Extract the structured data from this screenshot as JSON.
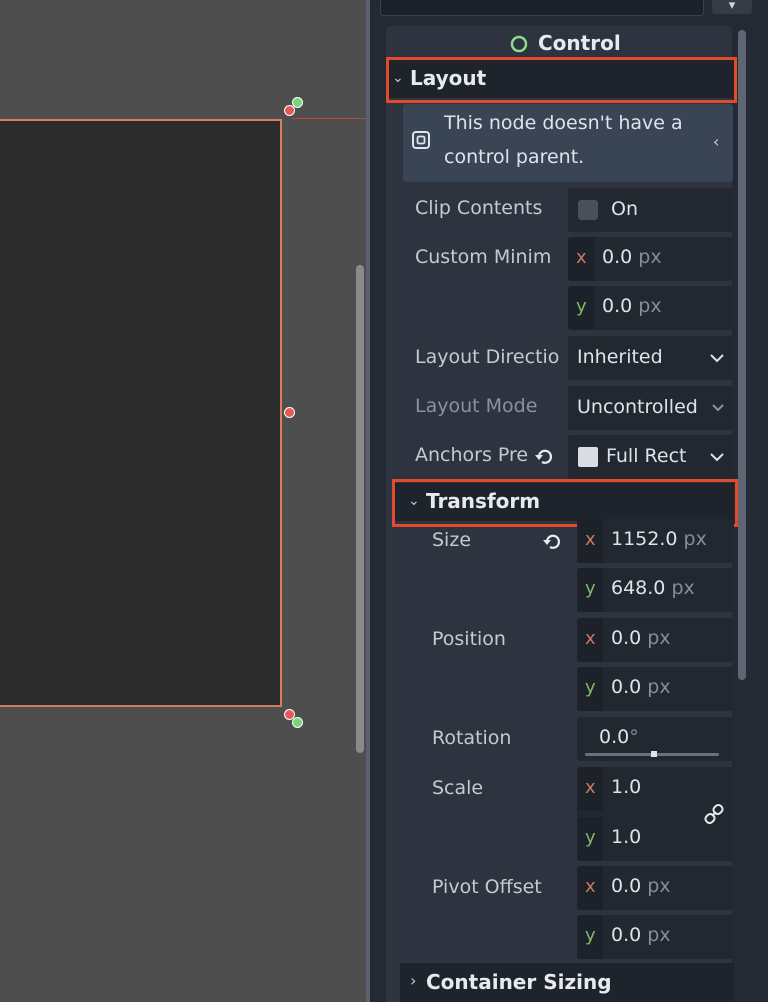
{
  "inspector": {
    "header_title": "Control",
    "sections": {
      "layout": "Layout",
      "transform": "Transform",
      "container_sizing": "Container Sizing"
    },
    "warning": {
      "line1": "This node doesn't have a",
      "line2": "control parent."
    },
    "props": {
      "clip_contents": {
        "label": "Clip Contents",
        "value": "On"
      },
      "custom_min": {
        "label": "Custom Minim",
        "x": "0.0",
        "y": "0.0",
        "unit": "px"
      },
      "layout_direction": {
        "label": "Layout Directio",
        "value": "Inherited"
      },
      "layout_mode": {
        "label": "Layout Mode",
        "value": "Uncontrolled"
      },
      "anchors_preset": {
        "label": "Anchors Pre",
        "value": "Full Rect"
      },
      "size": {
        "label": "Size",
        "x": "1152.0",
        "y": "648.0",
        "unit": "px"
      },
      "position": {
        "label": "Position",
        "x": "0.0",
        "y": "0.0",
        "unit": "px"
      },
      "rotation": {
        "label": "Rotation",
        "value": "0.0",
        "unit": "°"
      },
      "scale": {
        "label": "Scale",
        "x": "1.0",
        "y": "1.0"
      },
      "pivot_offset": {
        "label": "Pivot Offset",
        "x": "0.0",
        "y": "0.0",
        "unit": "px"
      }
    },
    "axis": {
      "x": "x",
      "y": "y"
    }
  },
  "colors": {
    "highlight": "#e14a2a",
    "axis_x": "#c97a62",
    "axis_y": "#7fb86a",
    "selection_border": "#d4805a"
  },
  "icons": [
    "control-node-icon",
    "warning-box-icon",
    "reset-icon",
    "link-icon",
    "chevron-down-icon",
    "chevron-right-icon",
    "chevron-left-icon"
  ]
}
